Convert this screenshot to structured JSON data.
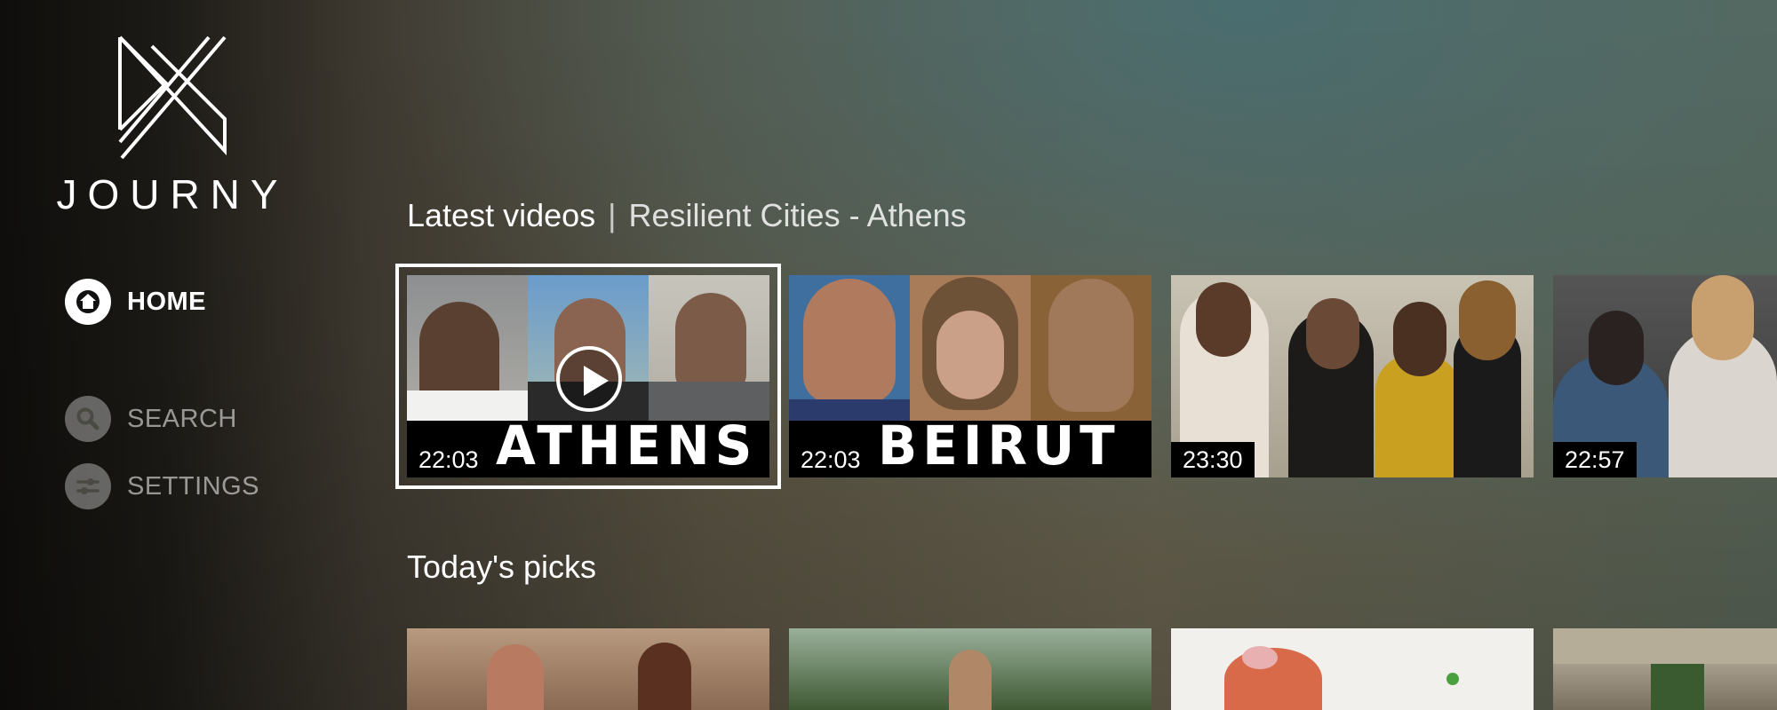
{
  "app": {
    "name": "JOURNY"
  },
  "nav": {
    "items": [
      {
        "label": "HOME",
        "icon": "home-icon",
        "active": true
      },
      {
        "label": "SEARCH",
        "icon": "search-icon",
        "active": false
      },
      {
        "label": "SETTINGS",
        "icon": "settings-sliders-icon",
        "active": false
      }
    ]
  },
  "sections": {
    "latest": {
      "title": "Latest videos",
      "separator": "|",
      "subtitle": "Resilient Cities - Athens",
      "videos": [
        {
          "duration": "22:03",
          "banner": "ATHENS",
          "focused": true
        },
        {
          "duration": "22:03",
          "banner": "BEIRUT",
          "focused": false
        },
        {
          "duration": "23:30",
          "banner": "",
          "focused": false
        },
        {
          "duration": "22:57",
          "banner": "",
          "focused": false
        }
      ]
    },
    "picks": {
      "title": "Today's picks"
    }
  },
  "colors": {
    "accent": "#ffffff",
    "background_dark": "#0f0e0c",
    "background_teal": "#466e73"
  }
}
